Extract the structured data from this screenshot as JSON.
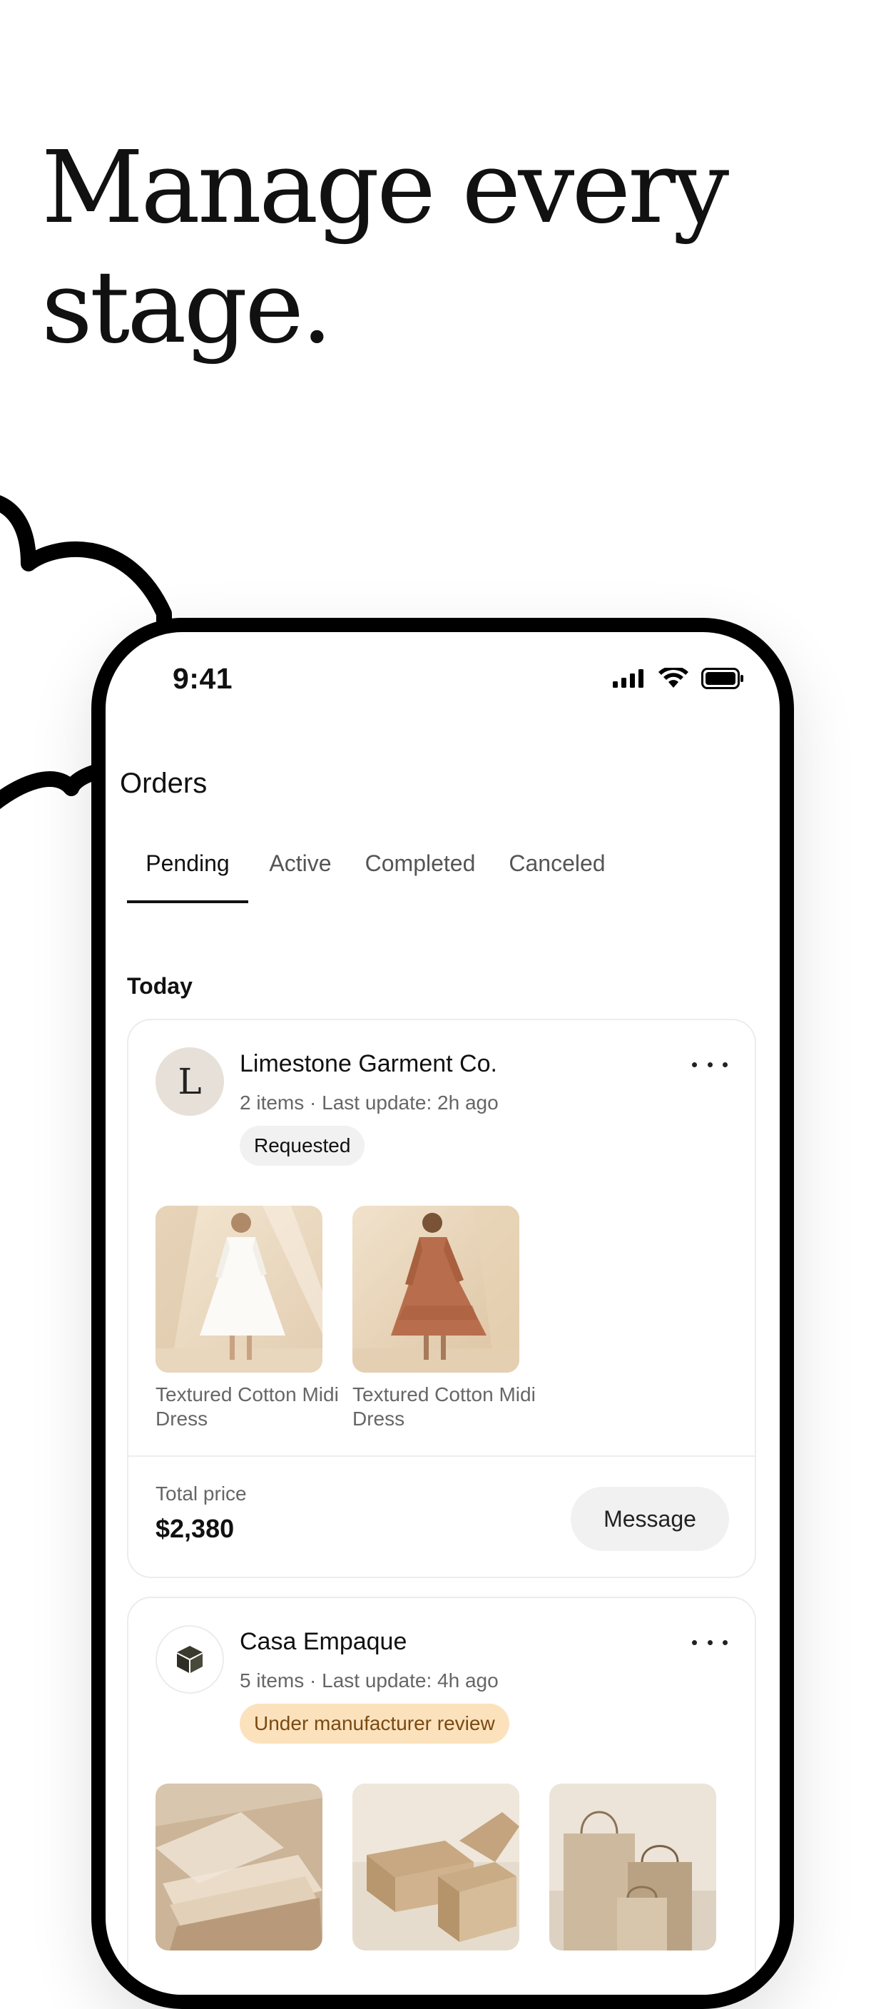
{
  "hero": {
    "line1": "Manage every",
    "line2": "stage."
  },
  "status_bar": {
    "time": "9:41"
  },
  "header": {
    "title": "Orders"
  },
  "tabs": [
    {
      "label": "Pending",
      "active": true
    },
    {
      "label": "Active",
      "active": false
    },
    {
      "label": "Completed",
      "active": false
    },
    {
      "label": "Canceled",
      "active": false
    }
  ],
  "section": {
    "label": "Today"
  },
  "orders": [
    {
      "avatar_letter": "L",
      "seller": "Limestone Garment Co.",
      "meta": "2 items · Last update: 2h ago",
      "status": "Requested",
      "items": [
        {
          "name": "Textured Cotton Midi Dress",
          "image": "white-dress"
        },
        {
          "name": "Textured Cotton Midi Dress",
          "image": "rust-dress"
        }
      ],
      "total_label": "Total price",
      "total_value": "$2,380",
      "action_label": "Message"
    },
    {
      "avatar_icon": "cube-logo-icon",
      "seller": "Casa Empaque",
      "meta": "5 items · Last update: 4h ago",
      "status": "Under manufacturer review",
      "items": [
        {
          "image": "tissue-paper"
        },
        {
          "image": "kraft-boxes"
        },
        {
          "image": "paper-bags"
        }
      ]
    }
  ],
  "colors": {
    "accent": "#111111",
    "warning_bg": "#fbe2bd",
    "warning_text": "#7a4a12",
    "neutral_badge": "#f1f1f1",
    "avatar_bg": "#e6e0d8"
  }
}
